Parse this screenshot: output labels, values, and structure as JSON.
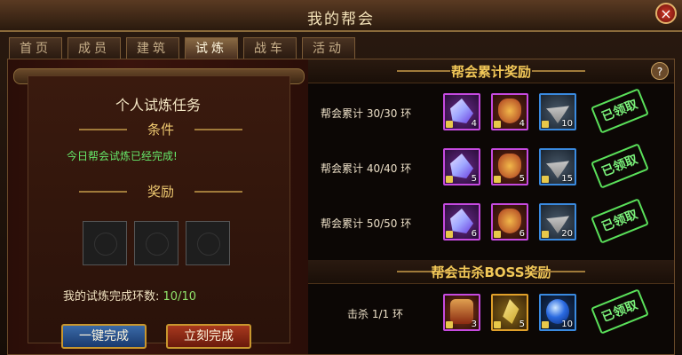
{
  "window": {
    "title": "我的帮会",
    "close_label": "×"
  },
  "tabs": [
    {
      "label": "首页",
      "active": false
    },
    {
      "label": "成员",
      "active": false
    },
    {
      "label": "建筑",
      "active": false
    },
    {
      "label": "试炼",
      "active": true
    },
    {
      "label": "战车",
      "active": false
    },
    {
      "label": "活动",
      "active": false
    }
  ],
  "left": {
    "task_title": "个人试炼任务",
    "condition_header": "条件",
    "condition_text": "今日帮会试炼已经完成!",
    "reward_header": "奖励",
    "progress_label": "我的试炼完成环数:",
    "progress_value": "10/10",
    "btn_instant": "一键完成",
    "btn_now": "立刻完成"
  },
  "right": {
    "cumulative_header": "帮会累计奖励",
    "help_label": "?",
    "boss_header": "帮会击杀BOSS奖励",
    "claimed_label": "已领取",
    "cumulative_rows": [
      {
        "label": "帮会累计 30/30 环",
        "counts": [
          "4",
          "4",
          "10"
        ]
      },
      {
        "label": "帮会累计 40/40 环",
        "counts": [
          "5",
          "5",
          "15"
        ]
      },
      {
        "label": "帮会累计 50/50 环",
        "counts": [
          "6",
          "6",
          "20"
        ]
      }
    ],
    "boss_rows": [
      {
        "label": "击杀 1/1 环",
        "counts": [
          "3",
          "5",
          "10"
        ]
      }
    ]
  },
  "colors": {
    "accent_gold": "#f2c858",
    "claimed_green": "#7af07a",
    "progress_green": "#8fe26a"
  },
  "icons": [
    "crystal-item-icon",
    "mask-item-icon",
    "helmet-item-icon",
    "shield-item-icon",
    "gem-item-icon",
    "orb-item-icon"
  ]
}
